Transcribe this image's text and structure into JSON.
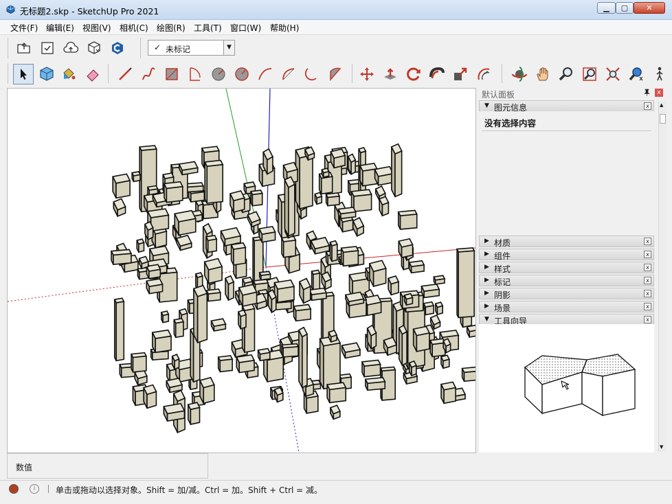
{
  "window": {
    "title": "无标题2.skp - SketchUp Pro 2021",
    "min_glyph": "▁",
    "max_glyph": "▢",
    "close_glyph": "✕"
  },
  "menu": [
    "文件(F)",
    "编辑(E)",
    "视图(V)",
    "相机(C)",
    "绘图(R)",
    "工具(T)",
    "窗口(W)",
    "帮助(H)"
  ],
  "toolbar_top": {
    "buttons": [
      "open-icon",
      "model-info-icon",
      "cloud-upload-icon",
      "3d-warehouse-icon",
      "extension-warehouse-icon"
    ],
    "tag_select": {
      "check": "✓",
      "value": "未标记",
      "arrow": "▼"
    }
  },
  "toolbar_main": {
    "buttons": [
      "select-icon",
      "make-component-icon",
      "paint-bucket-icon",
      "eraser-icon",
      "line-icon",
      "freehand-icon",
      "rectangle-icon",
      "rotated-rectangle-icon",
      "circle-icon",
      "polygon-icon",
      "arc-icon",
      "two-point-arc-icon",
      "three-point-arc-icon",
      "pie-icon",
      "move-icon",
      "push-pull-icon",
      "rotate-icon",
      "follow-me-icon",
      "scale-icon",
      "offset-icon",
      "orbit-icon",
      "pan-icon",
      "zoom-icon",
      "zoom-window-icon",
      "zoom-extents-icon",
      "position-camera-icon",
      "walk-icon"
    ]
  },
  "tray": {
    "title": "默认面板",
    "pin": "📌",
    "close": "x",
    "entity_info": {
      "title": "图元信息",
      "expanded": true,
      "content": "没有选择内容"
    },
    "panels": [
      {
        "title": "材质"
      },
      {
        "title": "组件"
      },
      {
        "title": "样式"
      },
      {
        "title": "标记"
      },
      {
        "title": "阴影"
      },
      {
        "title": "场景"
      }
    ],
    "instructor": {
      "title": "工具向导",
      "expanded": true
    },
    "collapsed_arrow": "▶",
    "expanded_arrow": "▼",
    "panel_close": "x"
  },
  "measurements": {
    "label": "数值"
  },
  "status": {
    "info_glyph": "i",
    "text": "单击或拖动以选择对象。Shift = 加/减。Ctrl = 加。Shift + Ctrl = 减。"
  },
  "colors": {
    "title_bar": "#c7daf0",
    "building_face": "#e8e6d6",
    "axis_red": "#d02020",
    "axis_green": "#20a020",
    "axis_blue": "#2020c0",
    "viewport_bg": "#ffffff"
  }
}
